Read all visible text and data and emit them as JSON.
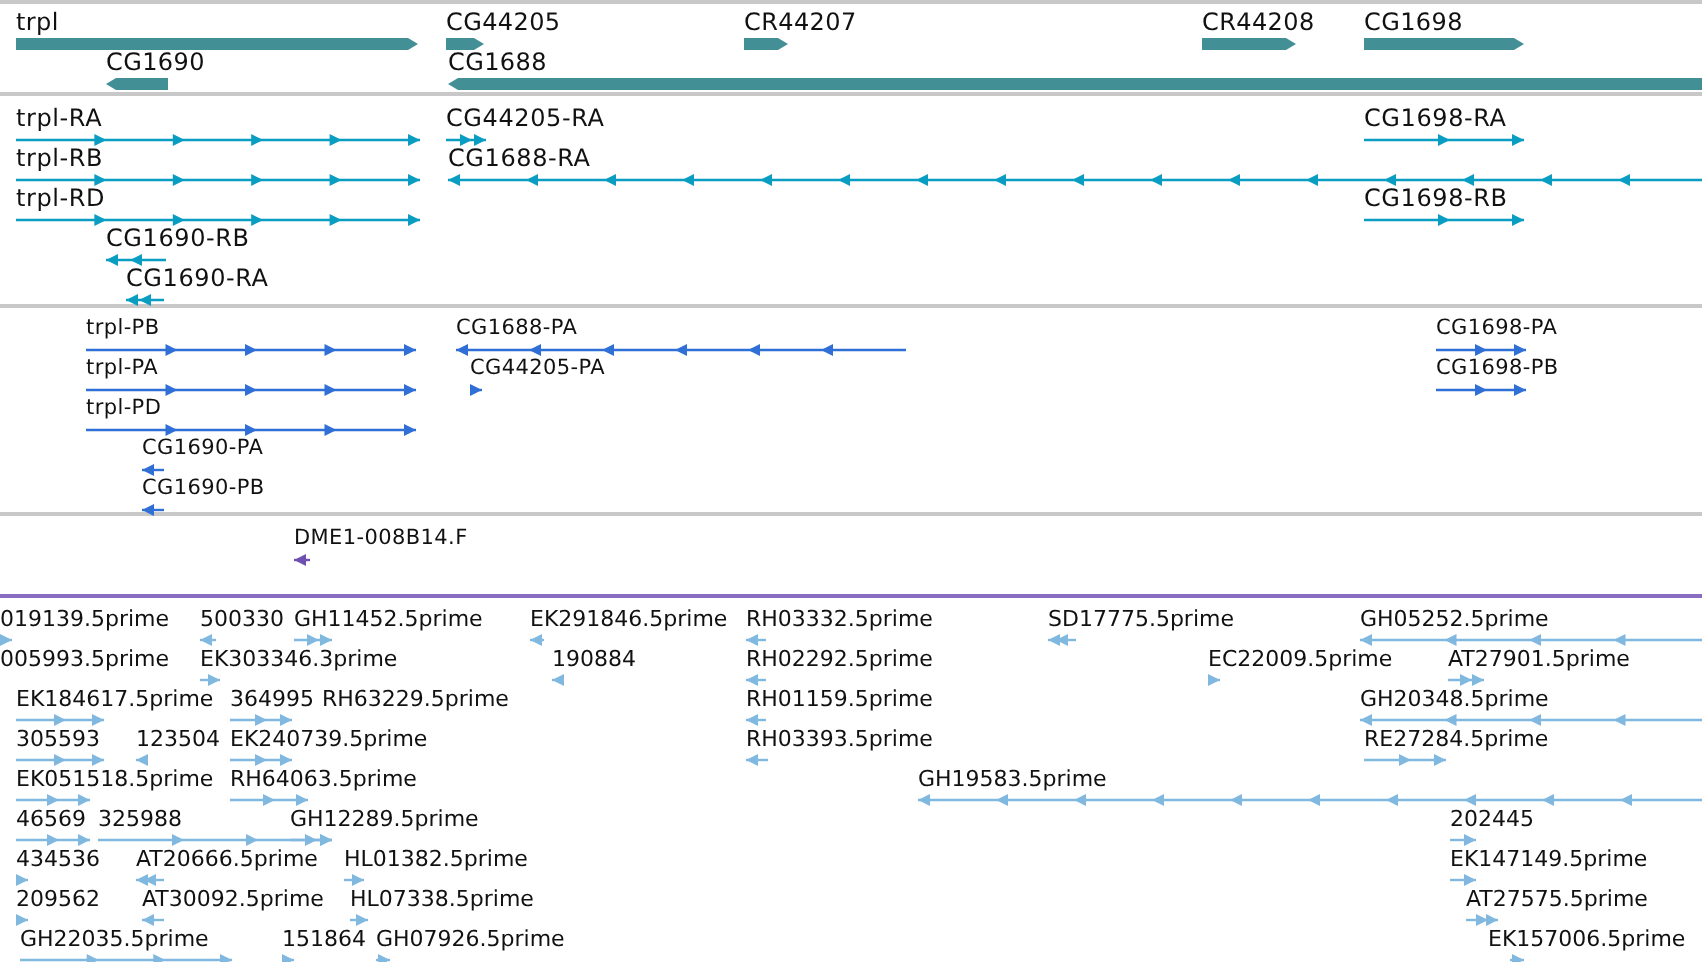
{
  "tracks": [
    {
      "kind": "gene",
      "features": [
        {
          "label": "trpl",
          "reverse": false
        },
        {
          "label": "CG44205",
          "reverse": false
        },
        {
          "label": "CR44207",
          "reverse": false
        },
        {
          "label": "CR44208",
          "reverse": false
        },
        {
          "label": "CG1698",
          "reverse": false
        },
        {
          "label": "CG1690",
          "reverse": true
        },
        {
          "label": "CG1688",
          "reverse": true
        }
      ]
    },
    {
      "kind": "transcript",
      "features": [
        {
          "label": "trpl-RA",
          "reverse": false
        },
        {
          "label": "CG44205-RA",
          "reverse": false
        },
        {
          "label": "CG1698-RA",
          "reverse": false
        },
        {
          "label": "trpl-RB",
          "reverse": false
        },
        {
          "label": "CG1688-RA",
          "reverse": true
        },
        {
          "label": "trpl-RD",
          "reverse": false
        },
        {
          "label": "CG1698-RB",
          "reverse": false
        },
        {
          "label": "CG1690-RB",
          "reverse": true
        },
        {
          "label": "CG1690-RA",
          "reverse": true
        }
      ]
    },
    {
      "kind": "protein",
      "features": [
        {
          "label": "trpl-PB",
          "reverse": false
        },
        {
          "label": "CG1688-PA",
          "reverse": true
        },
        {
          "label": "CG1698-PA",
          "reverse": false
        },
        {
          "label": "trpl-PA",
          "reverse": false
        },
        {
          "label": "CG44205-PA",
          "reverse": false
        },
        {
          "label": "CG1698-PB",
          "reverse": false
        },
        {
          "label": "trpl-PD",
          "reverse": false
        },
        {
          "label": "CG1690-PA",
          "reverse": true
        },
        {
          "label": "CG1690-PB",
          "reverse": true
        }
      ]
    },
    {
      "kind": "clone",
      "features": [
        {
          "label": "DME1-008B14.F",
          "reverse": true
        }
      ]
    },
    {
      "kind": "est",
      "features": [
        {
          "label": "019139.5prime",
          "reverse": false
        },
        {
          "label": "500330",
          "reverse": true
        },
        {
          "label": "GH11452.5prime",
          "reverse": false
        },
        {
          "label": "EK291846.5prime",
          "reverse": true
        },
        {
          "label": "RH03332.5prime",
          "reverse": true
        },
        {
          "label": "SD17775.5prime",
          "reverse": true
        },
        {
          "label": "GH05252.5prime",
          "reverse": true
        },
        {
          "label": "005993.5prime"
        },
        {
          "label": "EK303346.3prime",
          "reverse": false
        },
        {
          "label": "190884",
          "reverse": true
        },
        {
          "label": "RH02292.5prime",
          "reverse": true
        },
        {
          "label": "EC22009.5prime",
          "reverse": false
        },
        {
          "label": "AT27901.5prime",
          "reverse": false
        },
        {
          "label": "EK184617.5prime",
          "reverse": false
        },
        {
          "label": "364995",
          "reverse": false
        },
        {
          "label": "RH63229.5prime"
        },
        {
          "label": "RH01159.5prime",
          "reverse": true
        },
        {
          "label": "GH20348.5prime",
          "reverse": true
        },
        {
          "label": "305593",
          "reverse": false
        },
        {
          "label": "123504",
          "reverse": true
        },
        {
          "label": "EK240739.5prime",
          "reverse": false
        },
        {
          "label": "RH03393.5prime",
          "reverse": true
        },
        {
          "label": "RE27284.5prime",
          "reverse": false
        },
        {
          "label": "EK051518.5prime",
          "reverse": false
        },
        {
          "label": "RH64063.5prime",
          "reverse": false
        },
        {
          "label": "GH19583.5prime",
          "reverse": true
        },
        {
          "label": "46569",
          "reverse": false
        },
        {
          "label": "325988",
          "reverse": false
        },
        {
          "label": "GH12289.5prime",
          "reverse": false
        },
        {
          "label": "202445",
          "reverse": false
        },
        {
          "label": "434536",
          "reverse": false
        },
        {
          "label": "AT20666.5prime",
          "reverse": true
        },
        {
          "label": "HL01382.5prime",
          "reverse": false
        },
        {
          "label": "EK147149.5prime",
          "reverse": false
        },
        {
          "label": "209562",
          "reverse": false
        },
        {
          "label": "AT30092.5prime",
          "reverse": true
        },
        {
          "label": "HL07338.5prime",
          "reverse": false
        },
        {
          "label": "AT27575.5prime",
          "reverse": false
        },
        {
          "label": "GH22035.5prime",
          "reverse": false
        },
        {
          "label": "151864",
          "reverse": false
        },
        {
          "label": "GH07926.5prime",
          "reverse": false
        },
        {
          "label": "EK157006.5prime",
          "reverse": false
        }
      ]
    }
  ]
}
